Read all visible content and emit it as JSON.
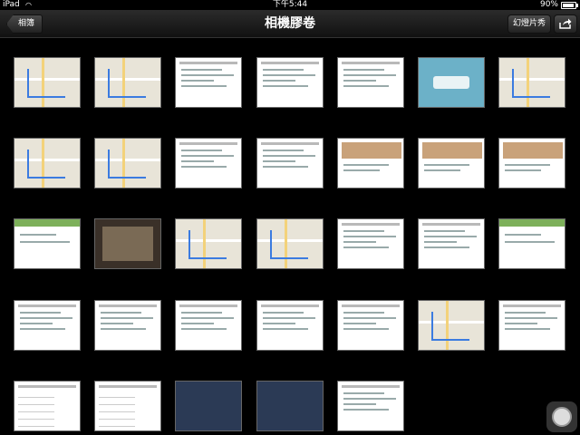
{
  "status_bar": {
    "carrier": "iPad",
    "time": "下午5:44",
    "battery": "90%",
    "battery_level": 0.9
  },
  "nav_bar": {
    "back_label": "相簿",
    "title": "相機膠卷",
    "slideshow_label": "幻燈片秀",
    "share_icon": "share-icon"
  },
  "grid": {
    "rows": 5,
    "columns": 7,
    "photo_count": 33
  },
  "home_icon": "assistive-touch-icon"
}
